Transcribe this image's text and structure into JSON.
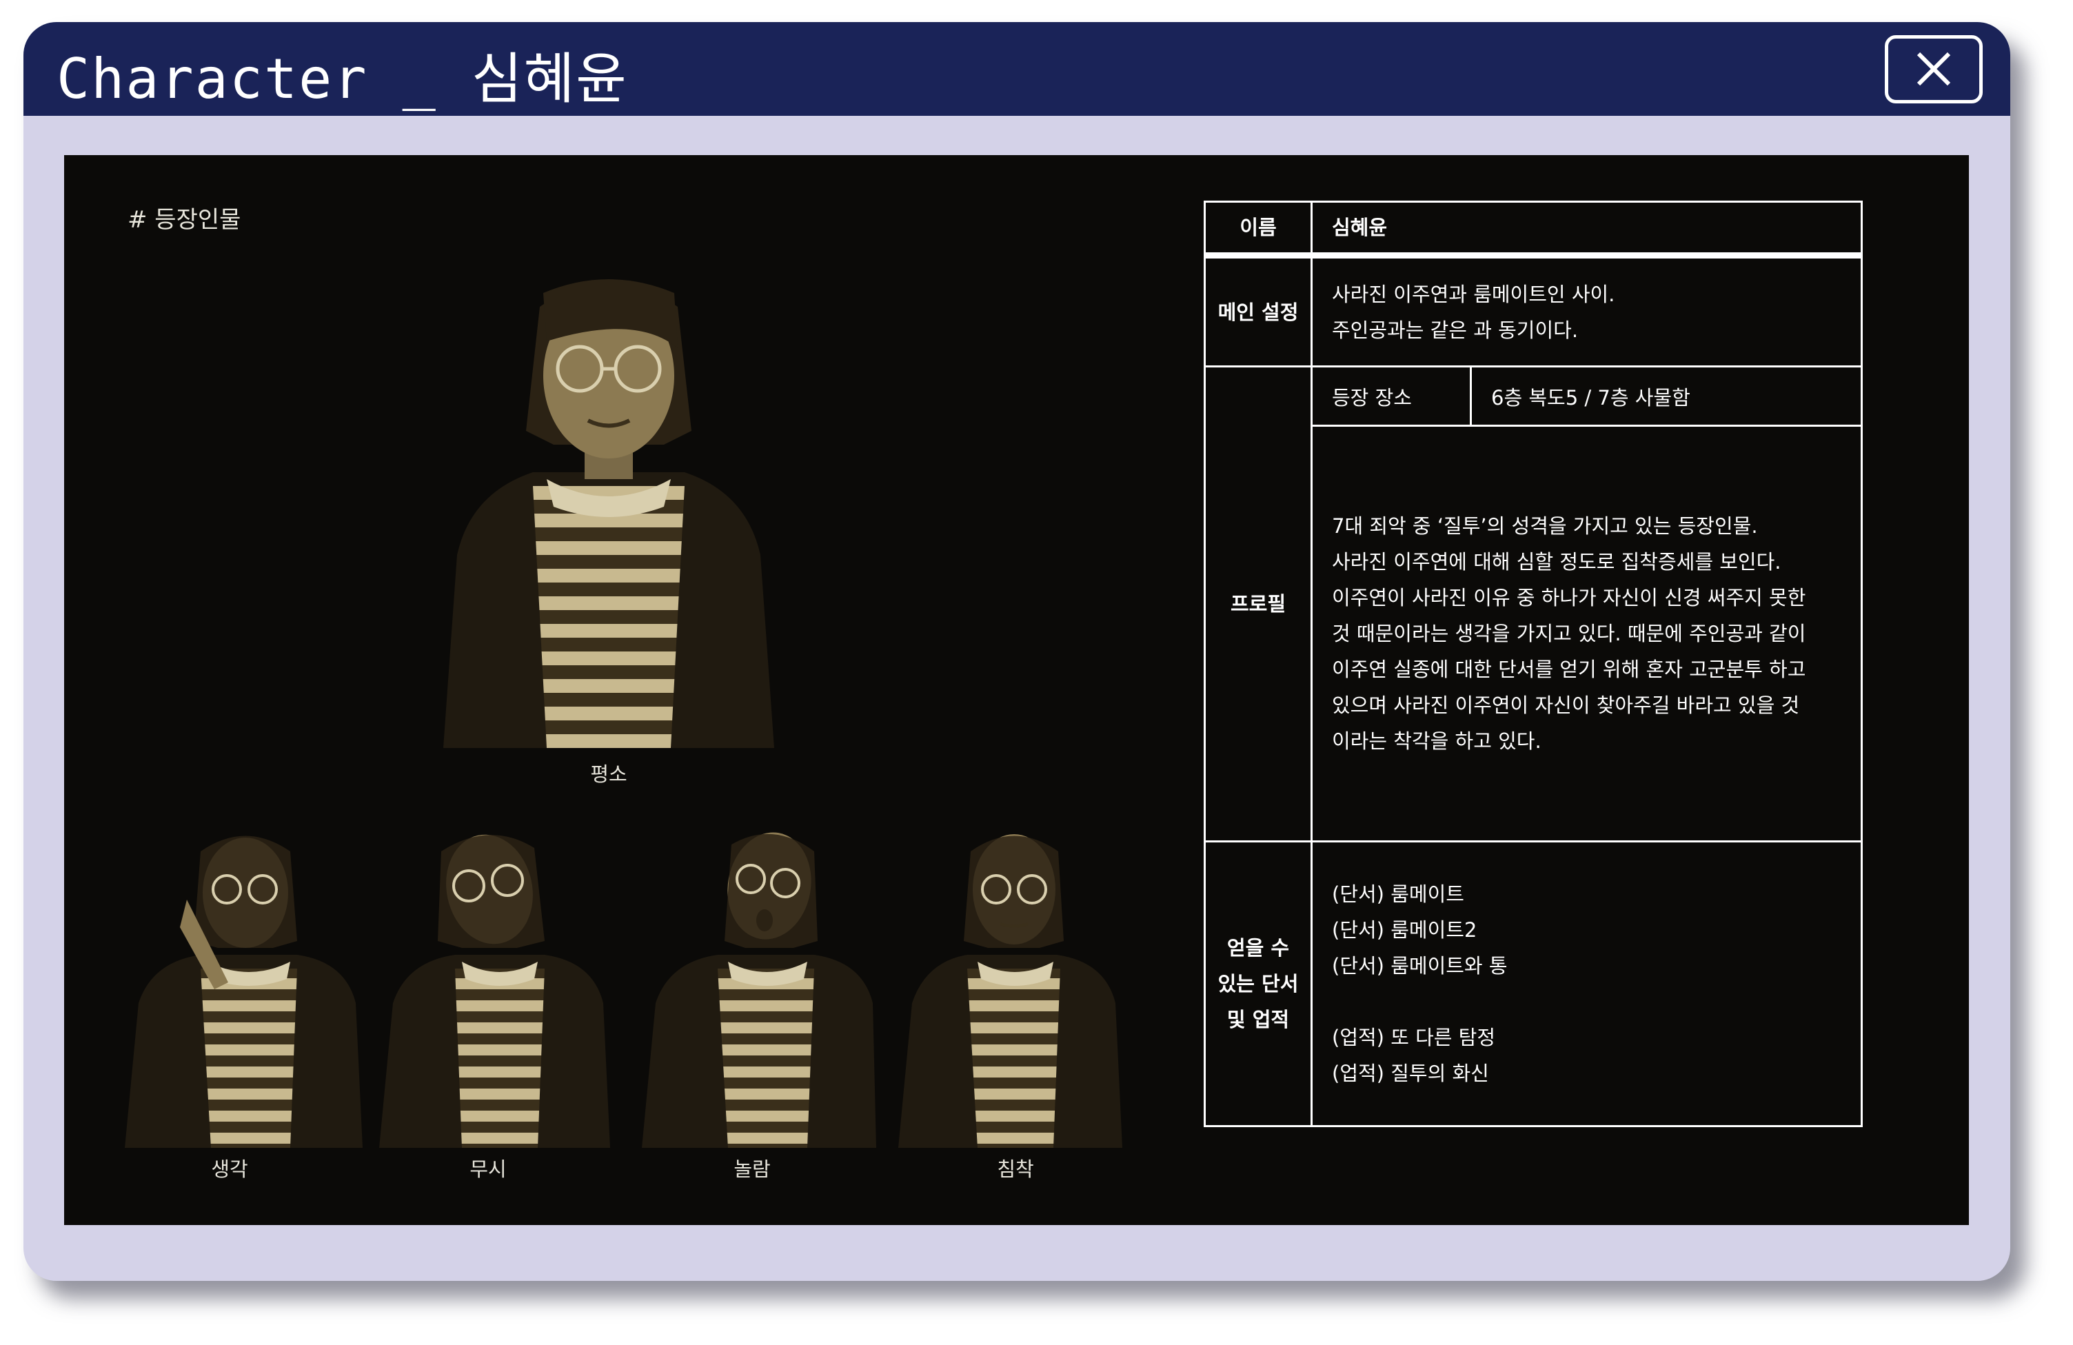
{
  "window": {
    "title": "Character _ 심혜윤",
    "close_icon": "close-icon"
  },
  "section": {
    "label": "# 등장인물"
  },
  "colors": {
    "titlebar": "#1a2358",
    "window_frame": "#d4d2e8",
    "content_bg": "#0b0a08",
    "sepia_dark": "#2e2615",
    "sepia_mid": "#6b5a3a",
    "sepia_light": "#c8b98f"
  },
  "portraits": {
    "main": {
      "caption": "평소"
    },
    "expressions": [
      {
        "caption": "생각"
      },
      {
        "caption": "무시"
      },
      {
        "caption": "놀람"
      },
      {
        "caption": "침착"
      }
    ]
  },
  "profile_table": {
    "name_label": "이름",
    "name_value": "심혜윤",
    "setting_label": "메인 설정",
    "setting_lines": [
      "사라진 이주연과 룸메이트인 사이.",
      "주인공과는 같은 과 동기이다."
    ],
    "profile_label": "프로필",
    "place_label": "등장 장소",
    "place_value": "6층 복도5 / 7층 사물함",
    "profile_lines": [
      "7대 죄악 중 ‘질투’의 성격을 가지고 있는 등장인물.",
      "사라진 이주연에 대해 심할 정도로 집착증세를 보인다.",
      "이주연이 사라진 이유 중 하나가 자신이 신경 써주지 못한",
      "것 때문이라는 생각을 가지고 있다. 때문에 주인공과 같이",
      "이주연 실종에 대한 단서를 얻기 위해 혼자 고군분투 하고",
      "있으며 사라진 이주연이 자신이 찾아주길 바라고 있을 것",
      "이라는 착각을 하고 있다."
    ],
    "items_label_lines": [
      "얻을 수",
      "있는 단서",
      "및 업적"
    ],
    "clues": [
      "(단서) 룸메이트",
      "(단서) 룸메이트2",
      "(단서) 룸메이트와 통"
    ],
    "achievements": [
      "(업적) 또 다른 탐정",
      "(업적) 질투의 화신"
    ]
  }
}
